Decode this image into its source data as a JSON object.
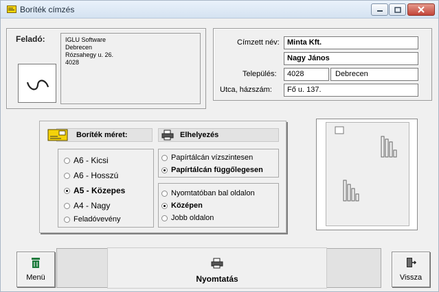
{
  "window": {
    "title": "Boríték címzés",
    "accent_color": "#f4d20a"
  },
  "sender": {
    "label": "Feladó:",
    "lines": [
      "IGLU Software",
      "Debrecen",
      "Rózsahegy u. 26.",
      "4028"
    ]
  },
  "recipient": {
    "name_label": "Címzett név:",
    "name_line1": "Minta Kft.",
    "name_line2": "Nagy János",
    "city_label": "Település:",
    "zip": "4028",
    "city": "Debrecen",
    "street_label": "Utca, házszám:",
    "street": "Fő u. 137."
  },
  "envelope_size": {
    "header": "Boríték méret:",
    "options": [
      {
        "label": "A6 - Kicsi",
        "selected": false
      },
      {
        "label": "A6 - Hosszú",
        "selected": false
      },
      {
        "label": "A5 - Közepes",
        "selected": true
      },
      {
        "label": "A4 - Nagy",
        "selected": false
      },
      {
        "label": "Feladóvevény",
        "selected": false
      }
    ]
  },
  "placement": {
    "header": "Elhelyezés",
    "orientation": [
      {
        "label": "Papírtálcán vízszintesen",
        "selected": false
      },
      {
        "label": "Papírtálcán függőlegesen",
        "selected": true
      }
    ],
    "position": [
      {
        "label": "Nyomtatóban bal oldalon",
        "selected": false
      },
      {
        "label": "Középen",
        "selected": true
      },
      {
        "label": "Jobb oldalon",
        "selected": false
      }
    ]
  },
  "buttons": {
    "menu": "Menü",
    "print": "Nyomtatás",
    "back": "Vissza"
  }
}
